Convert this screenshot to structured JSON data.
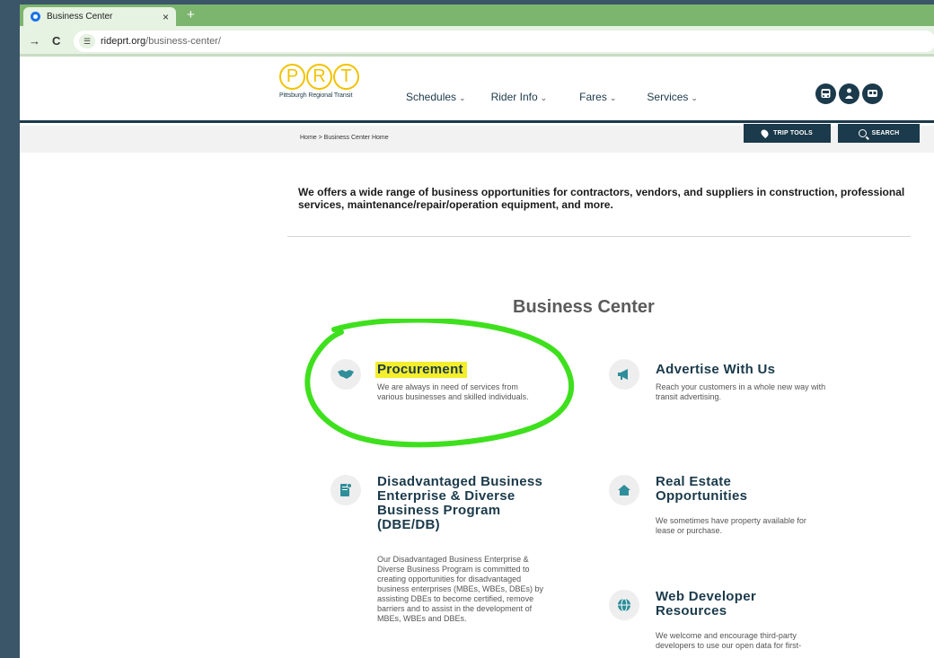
{
  "browser": {
    "tab_title": "Business Center",
    "tab_close": "×",
    "new_tab": "+",
    "back": "→",
    "reload": "C",
    "site_info": "☰",
    "url_host": "rideprt.org",
    "url_path": "/business-center/"
  },
  "header": {
    "logo_letters": [
      "P",
      "R",
      "T"
    ],
    "logo_subtitle": "Pittsburgh Regional Transit",
    "nav": [
      "Schedules",
      "Rider Info",
      "Fares",
      "Services"
    ],
    "nav_chevron": "⌄",
    "icons": [
      "bus-icon",
      "rider-icon",
      "rail-icon"
    ]
  },
  "subbar": {
    "breadcrumb": "Home  >  Business Center Home",
    "trip_tools": "TRIP TOOLS",
    "search": "SEARCH"
  },
  "intro_text": "We offers a wide range of business opportunities for contractors, vendors, and suppliers in construction, professional services, maintenance/repair/operation equipment, and more.",
  "section_title": "Business Center",
  "cards": [
    {
      "title": "Procurement",
      "desc": "We are always in need of services from various businesses and skilled individuals.",
      "icon": "handshake-icon"
    },
    {
      "title": "Advertise With Us",
      "desc": "Reach your customers in a whole new way with transit advertising.",
      "icon": "megaphone-icon"
    },
    {
      "title": "Disadvantaged Business Enterprise & Diverse Business Program (DBE/DB)",
      "desc": "Our Disadvantaged Business Enterprise & Diverse Business Program is committed to creating opportunities for disadvantaged business enterprises (MBEs, WBEs, DBEs) by assisting DBEs to become certified, remove barriers and to assist in the development of MBEs, WBEs and DBEs.",
      "icon": "certificate-icon"
    },
    {
      "title": "Real Estate Opportunities",
      "desc": "We sometimes have property available for lease or purchase.",
      "icon": "house-icon"
    },
    {
      "title": "Web Developer Resources",
      "desc": "We welcome and encourage third-party developers to use our open data for first-",
      "icon": "globe-icon"
    }
  ],
  "colors": {
    "brand_dark": "#1b3a4b",
    "brand_yellow": "#f2c200",
    "accent_teal": "#2f8e9a",
    "highlight_yellow": "#f4ee2c",
    "annotation_green": "#3ee01d"
  }
}
